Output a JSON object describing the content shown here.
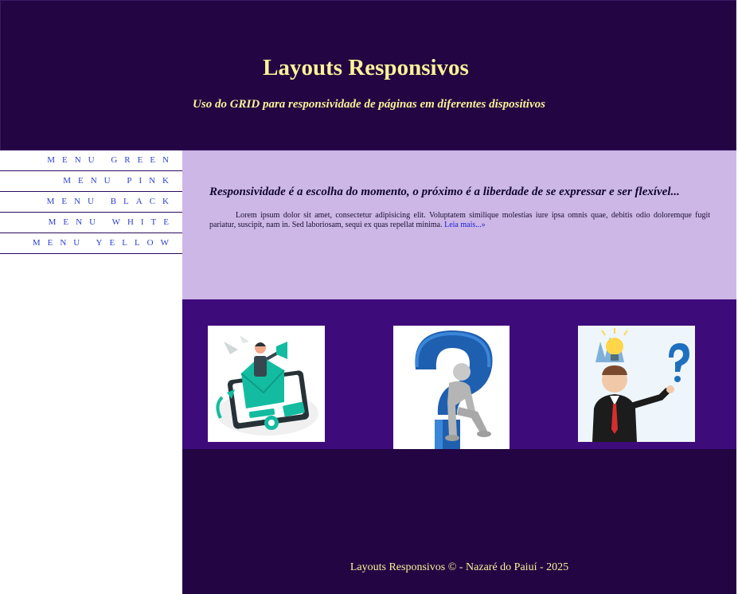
{
  "header": {
    "title": "Layouts Responsivos",
    "subtitle": "Uso do GRID para responsividade de páginas em diferentes dispositivos"
  },
  "sidebar": {
    "items": [
      {
        "label": "Menu Green"
      },
      {
        "label": "Menu Pink"
      },
      {
        "label": "Menu Black"
      },
      {
        "label": "Menu White"
      },
      {
        "label": "Menu Yellow"
      }
    ]
  },
  "content": {
    "heading": "Responsividade é a escolha do momento, o próximo é a liberdade de se expressar e ser flexível...",
    "body": "Lorem ipsum dolor sit amet, consectetur adipisicing elit. Voluptatem similique molestias iure ipsa omnis quae, debitis odio doloremque fugit pariatur, suscipit, nam in. Sed laboriosam, sequi ex quas repellat minima.",
    "read_more": "Leia mais...»"
  },
  "images": [
    {
      "name": "marketing-illustration"
    },
    {
      "name": "question-mark-figure"
    },
    {
      "name": "thinking-businessman"
    }
  ],
  "footer": {
    "text": "Layouts Responsivos © - Nazaré do Paiuí - 2025"
  },
  "colors": {
    "header_bg": "#220542",
    "title_color": "#fcf29a",
    "content_bg": "#cdb7e6",
    "images_bg": "#3e0b7a",
    "menu_link": "#2b3fd6"
  }
}
